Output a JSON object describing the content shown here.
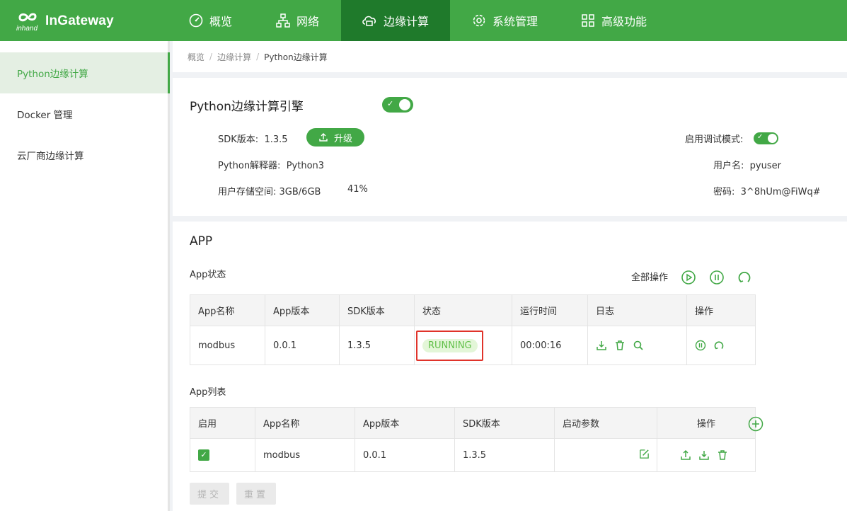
{
  "brand": {
    "logo_small": "inhand",
    "logo_text": "InGateway",
    "color": "#42a846",
    "active_color": "#1f7a2b"
  },
  "nav": [
    {
      "label": "概览",
      "icon": "dashboard-icon"
    },
    {
      "label": "网络",
      "icon": "network-icon"
    },
    {
      "label": "边缘计算",
      "icon": "cloud-compute-icon",
      "active": true
    },
    {
      "label": "系统管理",
      "icon": "gear-icon"
    },
    {
      "label": "高级功能",
      "icon": "grid-icon"
    }
  ],
  "sidebar": [
    {
      "label": "Python边缘计算",
      "active": true
    },
    {
      "label": "Docker 管理"
    },
    {
      "label": "云厂商边缘计算"
    }
  ],
  "breadcrumb": [
    "概览",
    "边缘计算",
    "Python边缘计算"
  ],
  "engine": {
    "title": "Python边缘计算引擎",
    "sdk_label": "SDK版本:",
    "sdk_value": "1.3.5",
    "upgrade_label": "升级",
    "interpreter_label": "Python解释器:",
    "interpreter_value": "Python3",
    "storage_label": "用户存储空间:",
    "storage_value": "3GB/6GB",
    "storage_percent": "41%",
    "debug_label": "启用调试模式:",
    "user_label": "用户名:",
    "user_value": "pyuser",
    "password_label": "密码:",
    "password_value": "3^8hUm@FiWq#"
  },
  "app": {
    "title": "APP",
    "status_title": "App状态",
    "all_ops_label": "全部操作",
    "status_headers": [
      "App名称",
      "App版本",
      "SDK版本",
      "状态",
      "运行时间",
      "日志",
      "操作"
    ],
    "status_row": {
      "name": "modbus",
      "app_version": "0.0.1",
      "sdk_version": "1.3.5",
      "state": "RUNNING",
      "uptime": "00:00:16"
    },
    "list_title": "App列表",
    "list_headers": [
      "启用",
      "App名称",
      "App版本",
      "SDK版本",
      "启动参数",
      "操作"
    ],
    "list_row": {
      "name": "modbus",
      "app_version": "0.0.1",
      "sdk_version": "1.3.5",
      "enabled_mark": "✓"
    },
    "submit_label": "提交",
    "reset_label": "重置"
  }
}
